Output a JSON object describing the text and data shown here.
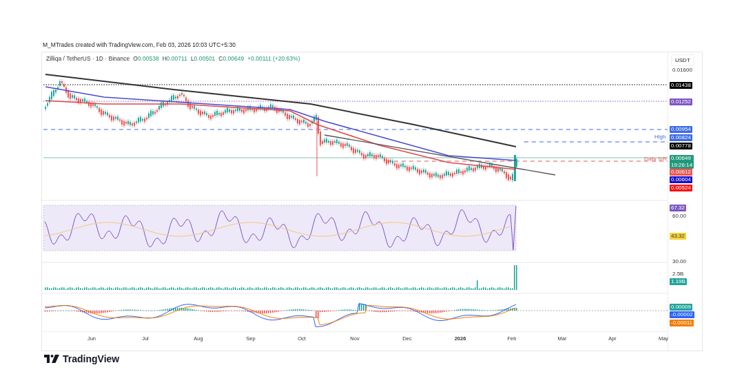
{
  "header": {
    "attribution": "M_MTrades created with TradingView.com, Feb 03, 2026 10:03 UTC+5:30"
  },
  "legend": {
    "symbol": "Zilliqa / TetherUS · 1D · Binance",
    "values": [
      {
        "label": "O",
        "value": "0.00538"
      },
      {
        "label": "H",
        "value": "0.00711"
      },
      {
        "label": "L",
        "value": "0.00501"
      },
      {
        "label": "C",
        "value": "0.00649"
      }
    ],
    "change": "+0.00111 (+20.63%)"
  },
  "level_labels": [
    {
      "text": "High",
      "kind": "resistance"
    },
    {
      "text": "Daily S/R",
      "kind": "support"
    }
  ],
  "price_axis": {
    "currency": "USDT",
    "ticks": [
      "0.01600"
    ],
    "tags": [
      {
        "text": "0.01438",
        "color": "#000000"
      },
      {
        "text": "0.01252",
        "color": "#7e57c2"
      },
      {
        "text": "0.00954",
        "color": "#3d6be8"
      },
      {
        "text": "0.00824",
        "color": "#3d6be8"
      },
      {
        "text": "0.00778",
        "color": "#000000"
      },
      {
        "text": "0.00649",
        "subtext": "19:26:14",
        "color": "#22997a"
      },
      {
        "text": "0.00612",
        "color": "#f05350"
      },
      {
        "text": "0.00604",
        "color": "#1a10c8"
      },
      {
        "text": "0.00524",
        "color": "#f51515"
      }
    ]
  },
  "rsi_axis": {
    "ticks": [
      "60.00",
      "30.00"
    ],
    "tags": [
      {
        "text": "67.32",
        "color": "#7e57c2"
      },
      {
        "text": "43.32",
        "color": "#f5d33b"
      }
    ]
  },
  "volume_axis": {
    "ticks": [
      "2.5B"
    ],
    "tags": [
      {
        "text": "1.19B",
        "color": "#22a39a"
      }
    ]
  },
  "macd_axis": {
    "tags": [
      {
        "text": "0.00009",
        "color": "#22a39a"
      },
      {
        "text": "-0.00002",
        "color": "#2962ff"
      },
      {
        "text": "-0.00011",
        "color": "#f57c00"
      }
    ]
  },
  "time_axis": [
    {
      "label": "Jun",
      "bold": false
    },
    {
      "label": "Jul",
      "bold": false
    },
    {
      "label": "Aug",
      "bold": false
    },
    {
      "label": "Sep",
      "bold": false
    },
    {
      "label": "Oct",
      "bold": false
    },
    {
      "label": "Nov",
      "bold": false
    },
    {
      "label": "Dec",
      "bold": false
    },
    {
      "label": "2026",
      "bold": true
    },
    {
      "label": "Feb",
      "bold": false
    },
    {
      "label": "Mar",
      "bold": false
    },
    {
      "label": "Apr",
      "bold": false
    },
    {
      "label": "May",
      "bold": false
    }
  ],
  "footer": {
    "brand": "TradingView"
  }
}
